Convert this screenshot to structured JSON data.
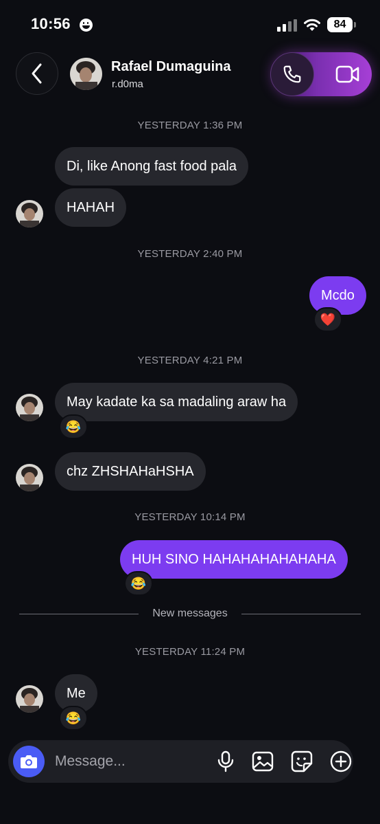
{
  "status_bar": {
    "time": "10:56",
    "battery": "84"
  },
  "header": {
    "back_icon": "chevron-left-icon",
    "name": "Rafael Dumaguina",
    "username": "r.d0ma",
    "audio_call_icon": "phone-icon",
    "video_call_icon": "video-camera-icon"
  },
  "conversation": {
    "timestamps": [
      "YESTERDAY 1:36 PM",
      "YESTERDAY 2:40 PM",
      "YESTERDAY 4:21 PM",
      "YESTERDAY 10:14 PM",
      "YESTERDAY 11:24 PM"
    ],
    "messages": [
      {
        "sender": "them",
        "text": "Di, like Anong fast food pala"
      },
      {
        "sender": "them",
        "text": "HAHAH"
      },
      {
        "sender": "me",
        "text": "Mcdo",
        "reaction": "❤️"
      },
      {
        "sender": "them",
        "text": "May kadate ka sa madaling araw ha",
        "reaction": "😂"
      },
      {
        "sender": "them",
        "text": "chz ZHSHAHaHSHA"
      },
      {
        "sender": "me",
        "text": "HUH SINO HAHAHAHAHAHAHA",
        "reaction": "😂"
      },
      {
        "sender": "them",
        "text": "Me",
        "reaction": "😂"
      }
    ],
    "new_messages_divider": "New messages"
  },
  "composer": {
    "placeholder": "Message...",
    "camera_icon": "camera-icon",
    "icons": [
      "microphone-icon",
      "image-icon",
      "sticker-icon",
      "plus-circle-icon"
    ]
  },
  "colors": {
    "background": "#0c0d12",
    "incoming_bubble": "#26272d",
    "outgoing_bubble": "#7c3cf0",
    "camera_button": "#4a5cf5"
  }
}
